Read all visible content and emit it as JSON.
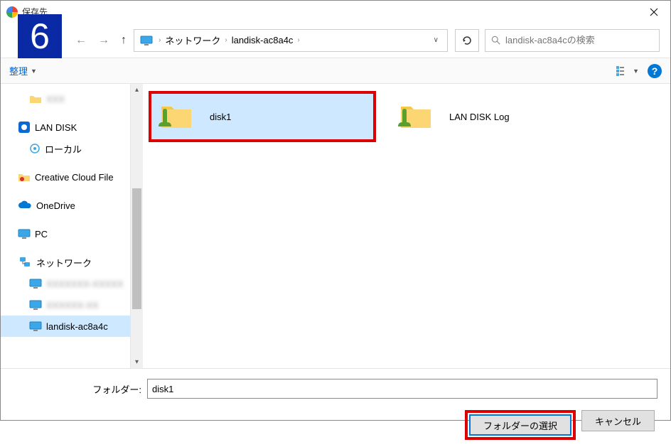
{
  "title": "保存先",
  "step_number": "6",
  "breadcrumb": {
    "location1": "ネットワーク",
    "location2": "landisk-ac8a4c"
  },
  "search": {
    "placeholder": "landisk-ac8a4cの検索"
  },
  "toolbar": {
    "organize": "整理"
  },
  "sidebar": {
    "blurred_item": "XXX",
    "lan_disk": "LAN DISK",
    "local": "ローカル",
    "creative_cloud": "Creative Cloud File",
    "onedrive": "OneDrive",
    "pc": "PC",
    "network": "ネットワーク",
    "net_item1": "XXXXXXX-XXXXX",
    "net_item2": "XXXXXX-XX",
    "net_item3": "landisk-ac8a4c"
  },
  "folders": [
    {
      "name": "disk1",
      "selected": true
    },
    {
      "name": "LAN DISK Log",
      "selected": false
    }
  ],
  "folder_input": {
    "label": "フォルダー:",
    "value": "disk1"
  },
  "buttons": {
    "select": "フォルダーの選択",
    "cancel": "キャンセル"
  }
}
